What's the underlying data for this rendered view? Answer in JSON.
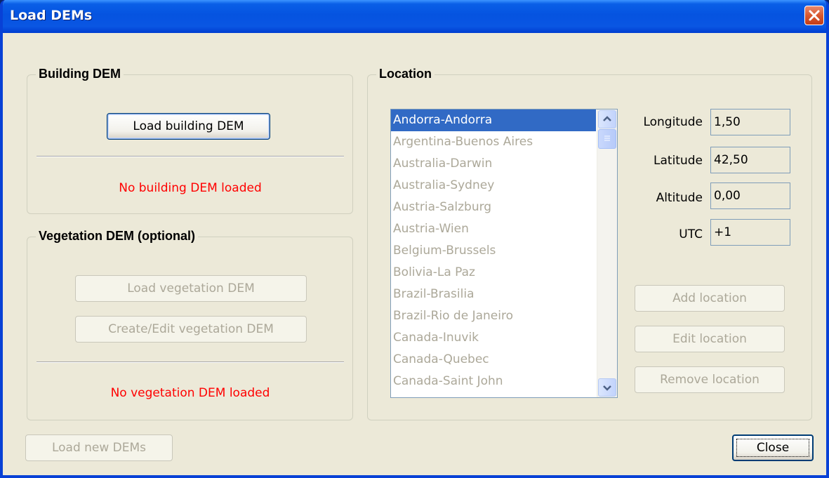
{
  "window": {
    "title": "Load DEMs"
  },
  "building": {
    "group_title": "Building DEM",
    "load_button": "Load building DEM",
    "status": "No building DEM loaded"
  },
  "vegetation": {
    "group_title": "Vegetation DEM (optional)",
    "load_button": "Load vegetation DEM",
    "edit_button": "Create/Edit vegetation DEM",
    "status": "No vegetation DEM loaded"
  },
  "location": {
    "group_title": "Location",
    "items": [
      "Andorra-Andorra",
      "Argentina-Buenos Aires",
      "Australia-Darwin",
      "Australia-Sydney",
      "Austria-Salzburg",
      "Austria-Wien",
      "Belgium-Brussels",
      "Bolivia-La Paz",
      "Brazil-Brasilia",
      "Brazil-Rio de Janeiro",
      "Canada-Inuvik",
      "Canada-Quebec",
      "Canada-Saint John"
    ],
    "selected_index": 0,
    "fields": {
      "longitude": {
        "label": "Longitude",
        "value": "1,50"
      },
      "latitude": {
        "label": "Latitude",
        "value": "42,50"
      },
      "altitude": {
        "label": "Altitude",
        "value": "0,00"
      },
      "utc": {
        "label": "UTC",
        "value": "+1"
      }
    },
    "add_button": "Add location",
    "edit_button": "Edit location",
    "remove_button": "Remove location"
  },
  "footer": {
    "load_new_button": "Load new DEMs",
    "close_button": "Close"
  },
  "colors": {
    "status_text": "#ff0000",
    "selection": "#316ac5",
    "titlebar": "#0553e0"
  }
}
